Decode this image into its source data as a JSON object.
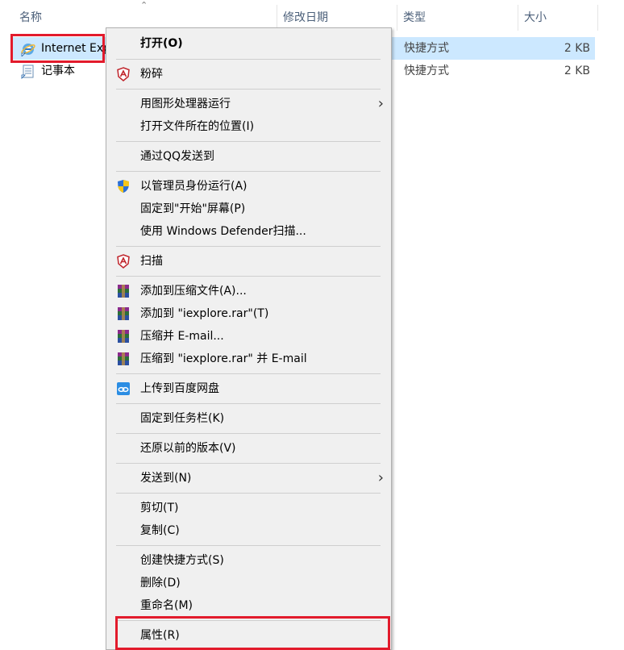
{
  "columns": {
    "name": "名称",
    "date": "修改日期",
    "type": "类型",
    "size": "大小"
  },
  "files": [
    {
      "name": "Internet Explorer",
      "type": "快捷方式",
      "size": "2 KB",
      "icon": "internet-explorer-icon"
    },
    {
      "name": "记事本",
      "type": "快捷方式",
      "size": "2 KB",
      "icon": "notepad-icon"
    }
  ],
  "menu": {
    "open": "打开(O)",
    "shred": "粉碎",
    "run_gpu": "用图形处理器运行",
    "open_location": "打开文件所在的位置(I)",
    "send_qq": "通过QQ发送到",
    "run_admin": "以管理员身份运行(A)",
    "pin_start": "固定到\"开始\"屏幕(P)",
    "defender_scan": "使用 Windows Defender扫描...",
    "scan": "扫描",
    "add_archive": "添加到压缩文件(A)...",
    "add_rar": "添加到 \"iexplore.rar\"(T)",
    "compress_email": "压缩并 E-mail...",
    "compress_rar_email": "压缩到 \"iexplore.rar\" 并 E-mail",
    "upload_baidu": "上传到百度网盘",
    "pin_taskbar": "固定到任务栏(K)",
    "restore_versions": "还原以前的版本(V)",
    "send_to": "发送到(N)",
    "cut": "剪切(T)",
    "copy": "复制(C)",
    "create_shortcut": "创建快捷方式(S)",
    "delete": "删除(D)",
    "rename": "重命名(M)",
    "properties": "属性(R)"
  },
  "colors": {
    "selection": "#cce8ff",
    "highlight_box": "#e21b2c",
    "menu_bg": "#f0f0f0"
  }
}
